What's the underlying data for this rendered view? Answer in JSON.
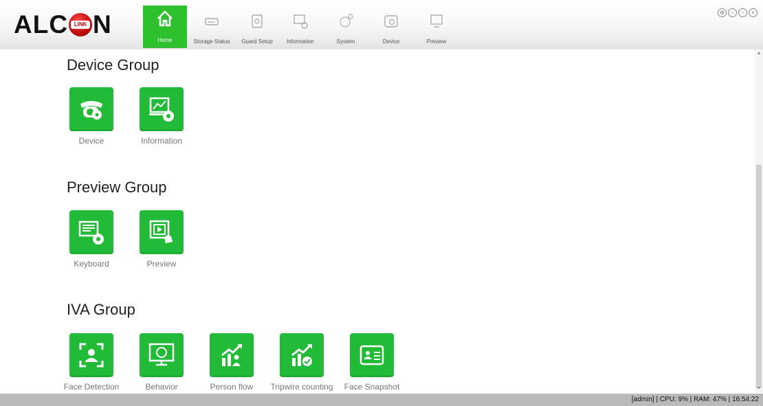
{
  "app": {
    "logo_text_left": "ALC",
    "logo_badge": "LINK",
    "logo_text_right": "N",
    "accent_color": "#22bb38"
  },
  "nav": [
    {
      "label": "Home",
      "icon": "home-icon",
      "active": true
    },
    {
      "label": "Storage Status",
      "icon": "hard-drive-icon",
      "active": false
    },
    {
      "label": "Guard Setup",
      "icon": "guard-icon",
      "active": false
    },
    {
      "label": "Information",
      "icon": "information-icon",
      "active": false
    },
    {
      "label": "System",
      "icon": "gear-icon",
      "active": false
    },
    {
      "label": "Device",
      "icon": "camera-icon",
      "active": false
    },
    {
      "label": "Preview",
      "icon": "preview-icon",
      "active": false
    }
  ],
  "window_controls": [
    "settings-icon",
    "minimize-icon",
    "restore-icon",
    "close-icon"
  ],
  "groups": [
    {
      "title": "Device Group",
      "items": [
        {
          "label": "Device",
          "icon": "camera-gear-icon"
        },
        {
          "label": "Information",
          "icon": "monitor-chart-gear-icon"
        }
      ]
    },
    {
      "title": "Preview Group",
      "items": [
        {
          "label": "Keyboard",
          "icon": "keyboard-gear-icon"
        },
        {
          "label": "Preview",
          "icon": "video-preview-icon"
        }
      ]
    },
    {
      "title": "IVA Group",
      "items": [
        {
          "label": "Face Detection",
          "icon": "face-scan-icon"
        },
        {
          "label": "Behavior",
          "icon": "monitor-behavior-icon"
        },
        {
          "label": "Person flow",
          "icon": "person-flow-chart-icon"
        },
        {
          "label": "Tripwire counting",
          "icon": "tripwire-chart-icon"
        },
        {
          "label": "Face Snapshot",
          "icon": "id-card-icon"
        }
      ]
    }
  ],
  "status": {
    "text": "[admin] | CPU: 9% | RAM: 47% | 16:54:22"
  }
}
